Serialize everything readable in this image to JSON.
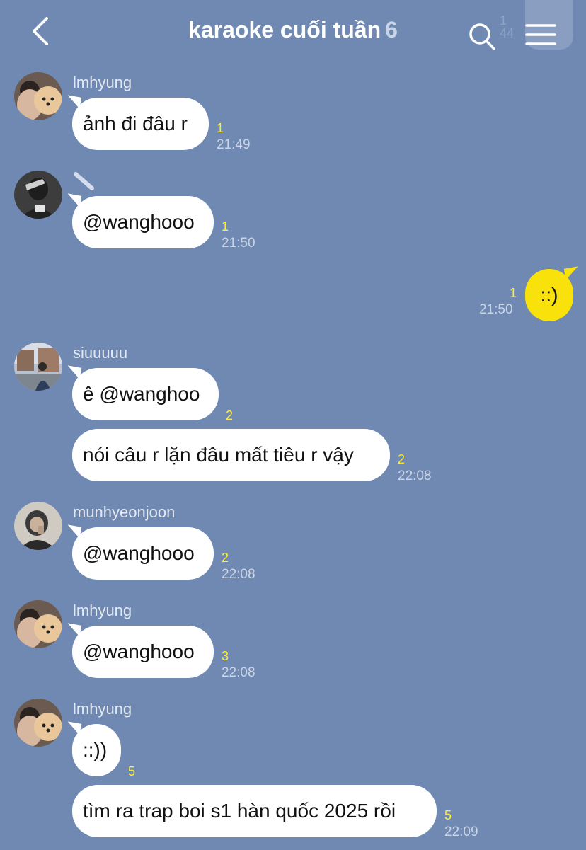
{
  "header": {
    "title": "karaoke cuối tuần",
    "member_count": "6",
    "back_icon": "chevron-left-icon",
    "search_icon": "search-icon",
    "menu_icon": "hamburger-menu-icon"
  },
  "messages": [
    {
      "sender": "lmhyung",
      "text": "ảnh đi đâu r",
      "read": "1",
      "time": "21:49"
    },
    {
      "sender": "",
      "text": "@wanghooo",
      "read": "1",
      "time": "21:50"
    },
    {
      "mine": true,
      "text": "::)",
      "read": "1",
      "time": "21:50"
    },
    {
      "sender": "siuuuuu",
      "text": "ê @wanghoo",
      "read": "2",
      "time": ""
    },
    {
      "sender": "",
      "text": "nói câu r lặn đâu mất tiêu r vậy",
      "read": "2",
      "time": "22:08"
    },
    {
      "sender": "munhyeonjoon",
      "text": "@wanghooo",
      "read": "2",
      "time": "22:08"
    },
    {
      "sender": "lmhyung",
      "text": "@wanghooo",
      "read": "3",
      "time": "22:08"
    },
    {
      "sender": "lmhyung",
      "text": "::))",
      "read": "5",
      "time": ""
    },
    {
      "sender": "",
      "text": "tìm ra trap boi s1 hàn quốc 2025 rồi",
      "read": "5",
      "time": "22:09"
    }
  ],
  "colors": {
    "background": "#6f89b2",
    "my_bubble": "#f9e10b",
    "other_bubble": "#ffffff",
    "read_count": "#ffee33"
  }
}
